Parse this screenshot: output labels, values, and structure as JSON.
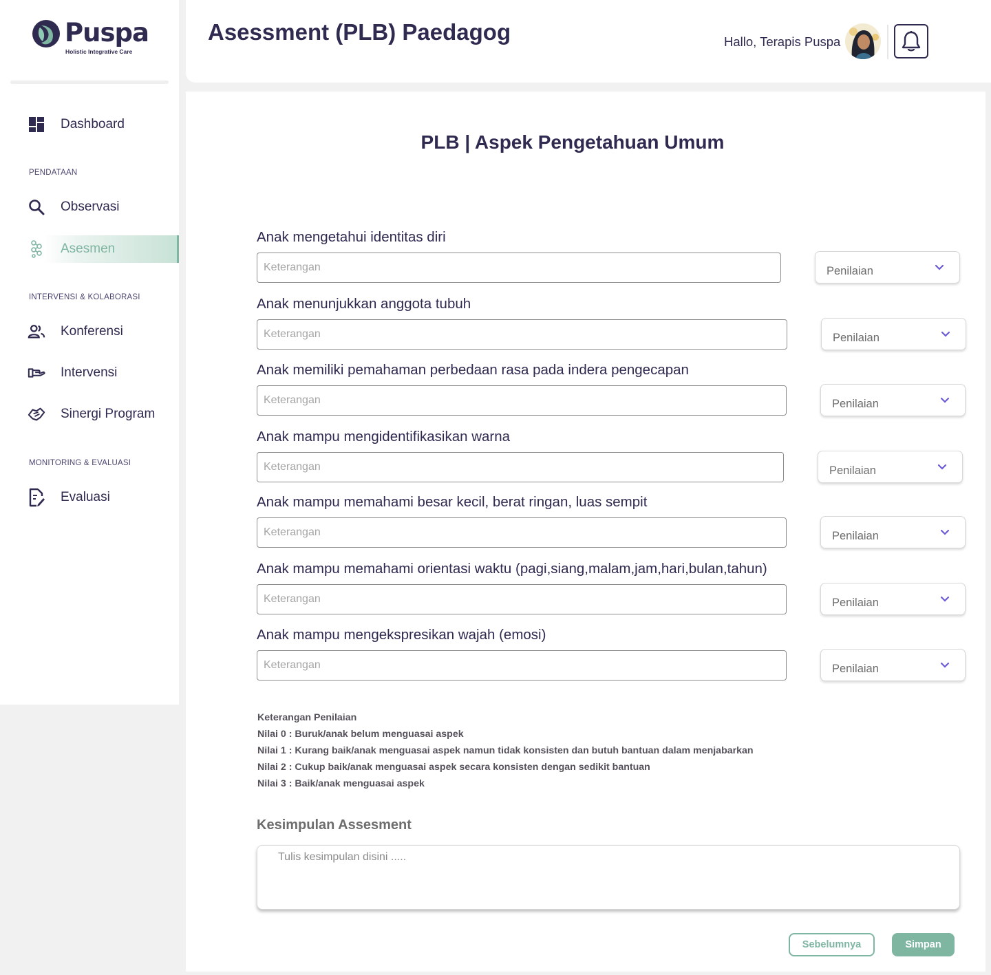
{
  "brand": {
    "name": "Puspa",
    "tagline": "Holistic Integrative Care"
  },
  "header": {
    "title": "Asessment (PLB) Paedagog",
    "greeting": "Hallo, Terapis Puspa"
  },
  "sidebar": {
    "dashboard": "Dashboard",
    "sections": {
      "pendataan": "PENDATAAN",
      "intervensi": "INTERVENSI & KOLABORASI",
      "monitoring": "MONITORING & EVALUASI"
    },
    "items": {
      "observasi": "Observasi",
      "asesmen": "Asesmen",
      "konferensi": "Konferensi",
      "intervensi": "Intervensi",
      "sinergi": "Sinergi Program",
      "evaluasi": "Evaluasi"
    }
  },
  "main": {
    "section_title": "PLB | Aspek  Pengetahuan Umum",
    "questions": [
      {
        "label": "Anak mengetahui identitas diri",
        "placeholder": "Keterangan",
        "select": "Penilaian"
      },
      {
        "label": "Anak menunjukkan anggota tubuh",
        "placeholder": "Keterangan",
        "select": "Penilaian"
      },
      {
        "label": "Anak memiliki pemahaman perbedaan rasa pada indera pengecapan",
        "placeholder": "Keterangan",
        "select": "Penilaian"
      },
      {
        "label": "Anak mampu mengidentifikasikan warna",
        "placeholder": "Keterangan",
        "select": "Penilaian"
      },
      {
        "label": "Anak mampu memahami besar kecil, berat ringan, luas sempit",
        "placeholder": "Keterangan",
        "select": "Penilaian"
      },
      {
        "label": "Anak mampu memahami orientasi waktu (pagi,siang,malam,jam,hari,bulan,tahun)",
        "placeholder": "Keterangan",
        "select": "Penilaian"
      },
      {
        "label": "Anak mampu mengekspresikan wajah (emosi)",
        "placeholder": "Keterangan",
        "select": "Penilaian"
      }
    ],
    "legend": {
      "title": "Keterangan Penilaian",
      "lines": [
        "Nilai 0 : Buruk/anak belum menguasai aspek",
        "Nilai 1 : Kurang baik/anak menguasai aspek namun tidak konsisten dan butuh bantuan dalam menjabarkan",
        "Nilai 2 : Cukup baik/anak menguasai aspek secara konsisten dengan sedikit bantuan",
        "Nilai 3 : Baik/anak menguasai aspek"
      ]
    },
    "conclusion": {
      "title": "Kesimpulan Assesment",
      "placeholder": "Tulis kesimpulan disini ....."
    },
    "buttons": {
      "previous": "Sebelumnya",
      "save": "Simpan"
    }
  },
  "colors": {
    "primary": "#2e2a50",
    "accent": "#7fb6a1",
    "chevron": "#6b5bd6"
  },
  "icons": [
    "dashboard-icon",
    "search-icon",
    "asesmen-icon",
    "people-icon",
    "intervensi-icon",
    "handshake-icon",
    "evaluasi-icon",
    "bell-icon",
    "chevron-down-icon"
  ]
}
